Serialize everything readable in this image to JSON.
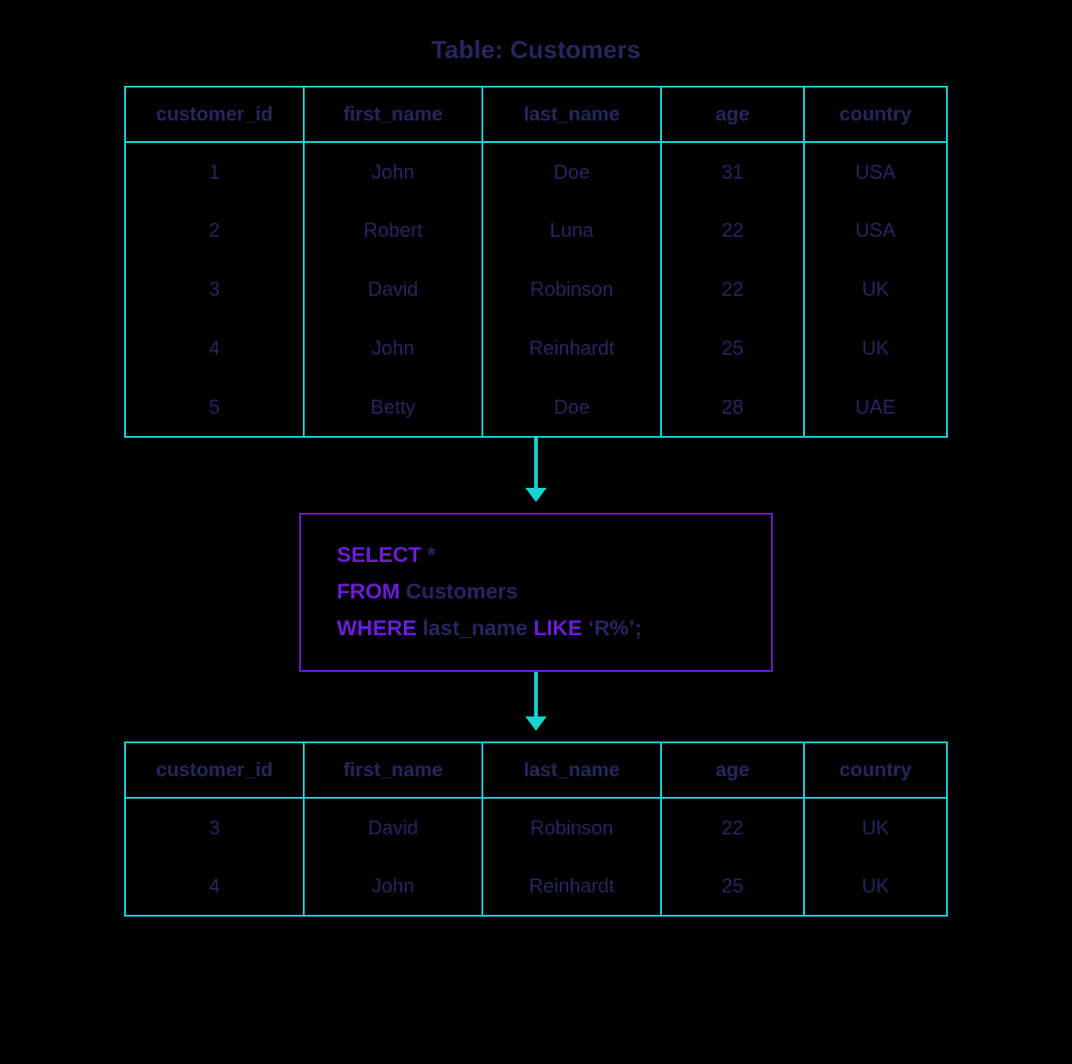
{
  "title": "Table: Customers",
  "columns": {
    "id": "customer_id",
    "first": "first_name",
    "last": "last_name",
    "age": "age",
    "country": "country"
  },
  "source_rows": [
    {
      "id": "1",
      "first": "John",
      "last": "Doe",
      "age": "31",
      "country": "USA"
    },
    {
      "id": "2",
      "first": "Robert",
      "last": "Luna",
      "age": "22",
      "country": "USA"
    },
    {
      "id": "3",
      "first": "David",
      "last": "Robinson",
      "age": "22",
      "country": "UK"
    },
    {
      "id": "4",
      "first": "John",
      "last": "Reinhardt",
      "age": "25",
      "country": "UK"
    },
    {
      "id": "5",
      "first": "Betty",
      "last": "Doe",
      "age": "28",
      "country": "UAE"
    }
  ],
  "result_rows": [
    {
      "id": "3",
      "first": "David",
      "last": "Robinson",
      "age": "22",
      "country": "UK"
    },
    {
      "id": "4",
      "first": "John",
      "last": "Reinhardt",
      "age": "25",
      "country": "UK"
    }
  ],
  "query": {
    "kw_select": "SELECT",
    "select_rest": " *",
    "kw_from": "FROM",
    "from_rest": " Customers",
    "kw_where": "WHERE",
    "where_mid": " last_name ",
    "kw_like": "LIKE",
    "like_rest": " ‘R%’;"
  }
}
